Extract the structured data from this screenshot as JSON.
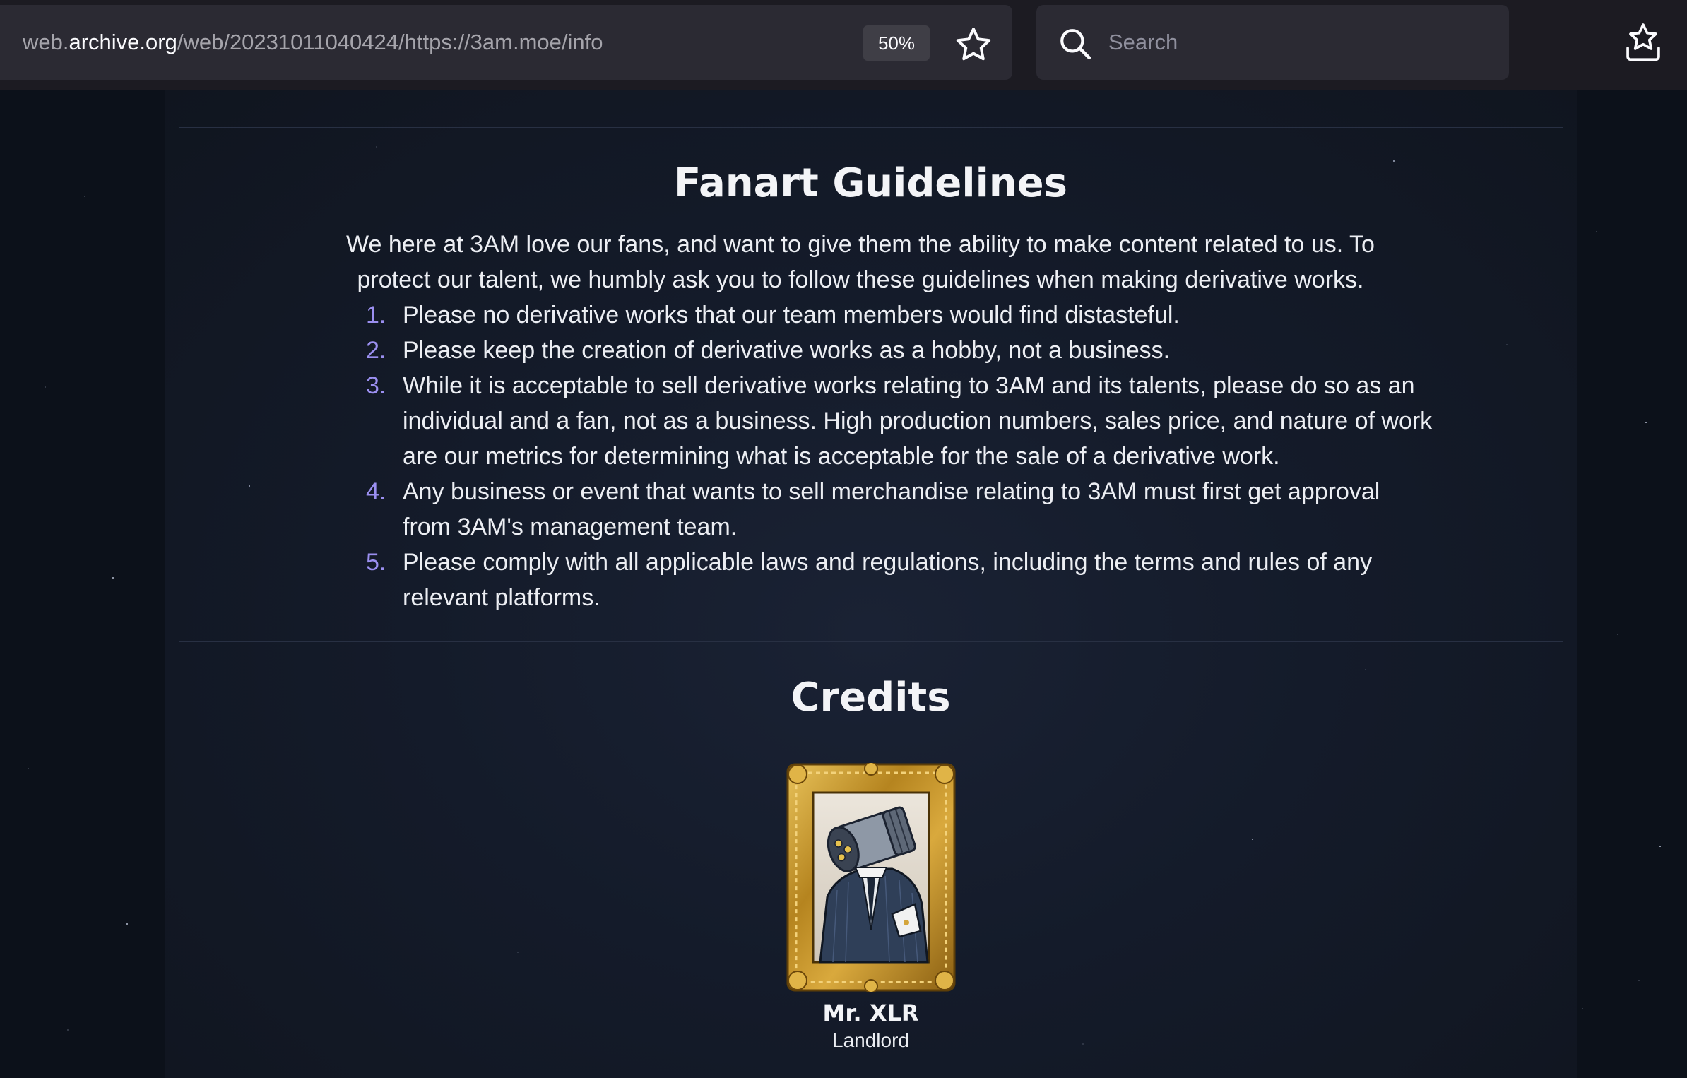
{
  "browser": {
    "url": {
      "prefix": "web.",
      "host": "archive.org",
      "path": "/web/20231011040424/https://3am.moe/info"
    },
    "zoom": "50%",
    "search": {
      "placeholder": "Search",
      "value": ""
    }
  },
  "fanart": {
    "title": "Fanart Guidelines",
    "intro_line1": "We here at 3AM love our fans, and want to give them the ability to make content related to us. To",
    "intro_line2": "protect our talent, we humbly ask you to follow these guidelines when making derivative works.",
    "items": [
      {
        "number": "1.",
        "lines": [
          "Please no derivative works that our team members would find distasteful."
        ]
      },
      {
        "number": "2.",
        "lines": [
          "Please keep the creation of derivative works as a hobby, not a business."
        ]
      },
      {
        "number": "3.",
        "lines": [
          "While it is acceptable to sell derivative works relating to 3AM and its talents, please do so as an",
          "individual and a fan, not as a business. High production numbers, sales price, and nature of work",
          "are our metrics for determining what is acceptable for the sale of a derivative work."
        ]
      },
      {
        "number": "4.",
        "lines": [
          "Any business or event that wants to sell merchandise relating to 3AM must first get approval",
          "from 3AM's management team."
        ]
      },
      {
        "number": "5.",
        "lines": [
          "Please comply with all applicable laws and regulations, including the terms and rules of any",
          "relevant platforms."
        ]
      }
    ]
  },
  "credits": {
    "title": "Credits",
    "people": [
      {
        "name": "Mr. XLR",
        "role": "Landlord",
        "icon": "framed-portrait"
      }
    ]
  },
  "colors": {
    "list_number": "#9b8ff0",
    "toolbar": "#1c1b22",
    "field": "#2b2a33",
    "frame_gold": "#c9962e"
  }
}
